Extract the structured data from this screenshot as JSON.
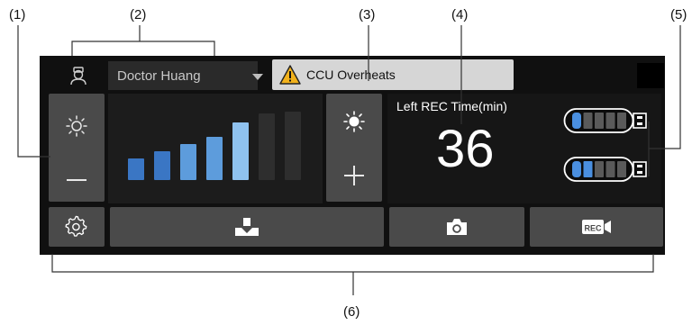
{
  "callouts": [
    "(1)",
    "(2)",
    "(3)",
    "(4)",
    "(5)",
    "(6)"
  ],
  "header": {
    "doctor_name": "Doctor Huang",
    "alarm_text": "CCU Overheats"
  },
  "brightness": {
    "level": 5,
    "max": 7,
    "colors": {
      "active_low": "#3a76c4",
      "active_high": "#8fc2ef",
      "inactive": "#2e2e2e"
    }
  },
  "recording": {
    "label": "Left REC Time(min)",
    "value": "36"
  },
  "batteries": [
    {
      "filled": 1,
      "total": 5
    },
    {
      "filled": 2,
      "total": 5
    }
  ],
  "icons": {
    "brightness_down": "sun-outline-icon",
    "brightness_up": "sun-filled-icon",
    "settings": "gear-icon",
    "scan": "scan-icon",
    "camera": "camera-icon",
    "record": "rec-video-icon"
  }
}
